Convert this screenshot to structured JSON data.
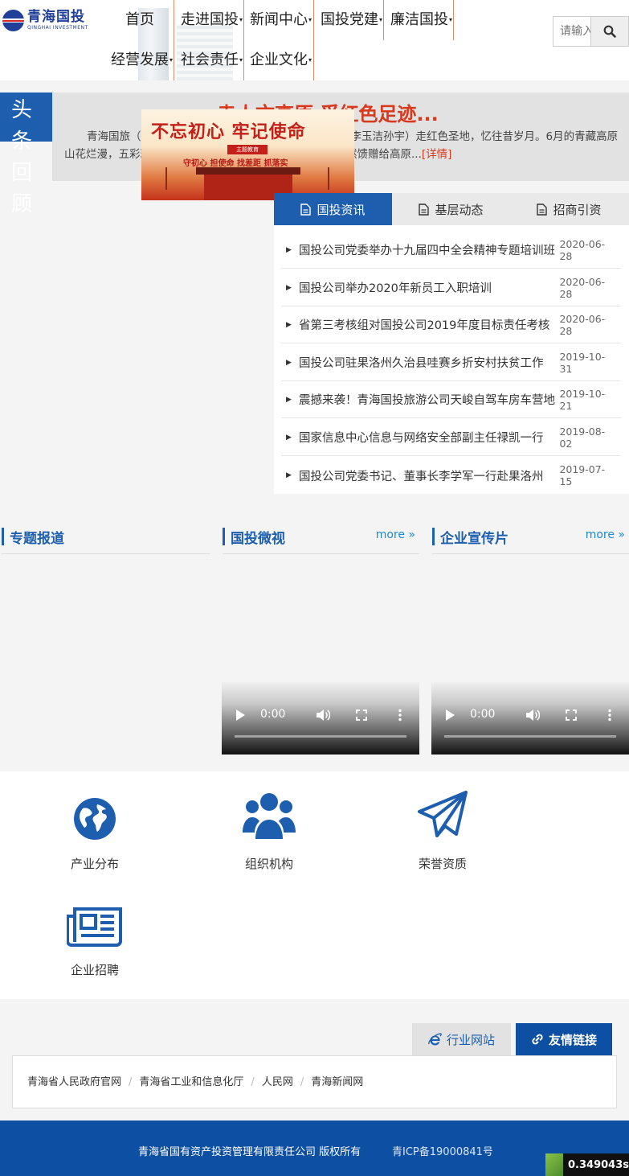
{
  "logo": {
    "cn": "青海国投",
    "en": "QINGHAI INVESTMENT"
  },
  "nav": {
    "items": [
      {
        "label": "首页",
        "caret": ""
      },
      {
        "label": "走进国投",
        "caret": "▾"
      },
      {
        "label": "新闻中心",
        "caret": "▾"
      },
      {
        "label": "国投党建",
        "caret": "▾"
      },
      {
        "label": "廉洁国投",
        "caret": "▾"
      },
      {
        "label": "经营发展",
        "caret": "▾"
      },
      {
        "label": "社会责任",
        "caret": "▾"
      },
      {
        "label": "企业文化",
        "caret": "▾"
      }
    ]
  },
  "search": {
    "placeholder": "请输入"
  },
  "headline": {
    "label_chars": [
      "头",
      "条",
      "回",
      "顾"
    ],
    "title": "走人文高原 觅红色足迹...",
    "body": "青海国旅（国投公司旅游板块）践行新思路（国投公司/李玉洁孙宇）走红色圣地，忆往昔岁月。6月的青藏高原山花烂漫，五彩斑斓的天然水墨画让人流连其中。在这大自然馈赠给高原...",
    "detail_link": "[详情]",
    "image_text": {
      "title": "不忘初心 牢记使命",
      "badge": "主题教育",
      "subtitle": "守初心 担使命 找差距 抓落实"
    }
  },
  "news_tabs": [
    {
      "label": "国投资讯",
      "icon": "document-icon",
      "active": true
    },
    {
      "label": "基层动态",
      "icon": "document-icon",
      "active": false
    },
    {
      "label": "招商引资",
      "icon": "document-icon",
      "active": false
    }
  ],
  "news": [
    {
      "title": "国投公司党委举办十九届四中全会精神专题培训班",
      "date": "2020-06-28"
    },
    {
      "title": "国投公司举办2020年新员工入职培训",
      "date": "2020-06-28"
    },
    {
      "title": "省第三考核组对国投公司2019年度目标责任考核",
      "date": "2020-06-28"
    },
    {
      "title": "国投公司驻果洛州久治县哇赛乡折安村扶贫工作",
      "date": "2019-10-31"
    },
    {
      "title": "震撼来袭！青海国投旅游公司天峻自驾车房车营地",
      "date": "2019-10-21"
    },
    {
      "title": "国家信息中心信息与网络安全部副主任禄凯一行",
      "date": "2019-08-02"
    },
    {
      "title": "国投公司党委书记、董事长李学军一行赴果洛州",
      "date": "2019-07-15"
    }
  ],
  "sections": {
    "special": {
      "label": "专题报道"
    },
    "micro_video": {
      "label": "国投微视",
      "more": "more »"
    },
    "promo_video": {
      "label": "企业宣传片",
      "more": "more »"
    }
  },
  "videos": [
    {
      "time": "0:00"
    },
    {
      "time": "0:00"
    }
  ],
  "quick_links": [
    {
      "label": "产业分布",
      "icon": "globe-icon"
    },
    {
      "label": "组织机构",
      "icon": "group-icon"
    },
    {
      "label": "荣誉资质",
      "icon": "paper-plane-icon"
    },
    {
      "label": "企业招聘",
      "icon": "newspaper-icon"
    }
  ],
  "link_tabs": {
    "industry": {
      "label": "行业网站",
      "icon": "ie-icon"
    },
    "friends": {
      "label": "友情链接",
      "icon": "link-icon"
    }
  },
  "friend_links": [
    "青海省人民政府官网",
    "青海省工业和信息化厅",
    "人民网",
    "青海新闻网"
  ],
  "footer": {
    "copyright": "青海省国有资产投资管理有限责任公司 版权所有",
    "icp": "青ICP备19000841号"
  },
  "timer": {
    "value": "0.349043s"
  },
  "colors": {
    "primary": "#1d5fae",
    "accent_red": "#d8381c",
    "footer": "#0d4fa3"
  }
}
